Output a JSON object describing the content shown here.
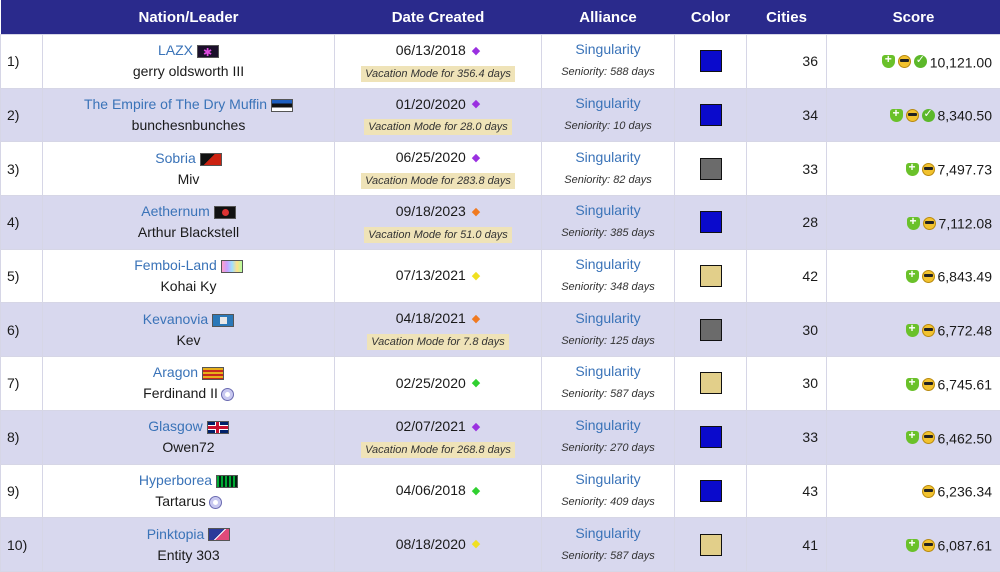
{
  "columns": [
    "Nation/Leader",
    "Date Created",
    "Alliance",
    "Color",
    "Cities",
    "Score"
  ],
  "colors": {
    "header_bg": "#2a2a8c",
    "even_row_bg": "#d8d8ee",
    "link": "#3a73b8",
    "vacation_bg": "#efe3b8",
    "blue": "#0a0acc",
    "gray": "#6b6b6b",
    "beige": "#e2cf8a",
    "diamond_purple": "#9a30e0",
    "diamond_orange": "#f07a20",
    "diamond_yellow": "#f0e020",
    "diamond_green": "#30d030"
  },
  "rows": [
    {
      "rank": "1)",
      "nation": "LAZX",
      "flag": "lazx",
      "leader": "gerry oldsworth III",
      "leader_badge": false,
      "date": "06/13/2018",
      "diamond": "purple",
      "vacation": "Vacation Mode for 356.4 days",
      "alliance": "Singularity",
      "seniority": "Seniority: 588 days",
      "color": "blue",
      "cities": "36",
      "score": "10,121.00",
      "icons": [
        "shield-plus-icon",
        "sunglasses-face-icon",
        "check-badge-icon"
      ]
    },
    {
      "rank": "2)",
      "nation": "The Empire of The Dry Muffin",
      "flag": "estonia",
      "leader": "bunchesnbunches",
      "leader_badge": false,
      "date": "01/20/2020",
      "diamond": "purple",
      "vacation": "Vacation Mode for 28.0 days",
      "alliance": "Singularity",
      "seniority": "Seniority: 10 days",
      "color": "blue",
      "cities": "34",
      "score": "8,340.50",
      "icons": [
        "shield-plus-icon",
        "sunglasses-face-icon",
        "check-badge-icon"
      ]
    },
    {
      "rank": "3)",
      "nation": "Sobria",
      "flag": "sobria",
      "leader": "Miv",
      "leader_badge": false,
      "date": "06/25/2020",
      "diamond": "purple",
      "vacation": "Vacation Mode for 283.8 days",
      "alliance": "Singularity",
      "seniority": "Seniority: 82 days",
      "color": "gray",
      "cities": "33",
      "score": "7,497.73",
      "icons": [
        "shield-plus-icon",
        "sunglasses-face-icon"
      ]
    },
    {
      "rank": "4)",
      "nation": "Aethernum",
      "flag": "aethernum",
      "leader": "Arthur Blackstell",
      "leader_badge": false,
      "date": "09/18/2023",
      "diamond": "orange",
      "vacation": "Vacation Mode for 51.0 days",
      "alliance": "Singularity",
      "seniority": "Seniority: 385 days",
      "color": "blue",
      "cities": "28",
      "score": "7,112.08",
      "icons": [
        "shield-plus-icon",
        "sunglasses-face-icon"
      ]
    },
    {
      "rank": "5)",
      "nation": "Femboi-Land",
      "flag": "femboi",
      "leader": "Kohai Ky",
      "leader_badge": false,
      "date": "07/13/2021",
      "diamond": "yellow",
      "vacation": "",
      "alliance": "Singularity",
      "seniority": "Seniority: 348 days",
      "color": "beige",
      "cities": "42",
      "score": "6,843.49",
      "icons": [
        "shield-plus-icon",
        "sunglasses-face-icon"
      ]
    },
    {
      "rank": "6)",
      "nation": "Kevanovia",
      "flag": "kevanovia",
      "leader": "Kev",
      "leader_badge": false,
      "date": "04/18/2021",
      "diamond": "orange",
      "vacation": "Vacation Mode for 7.8 days",
      "alliance": "Singularity",
      "seniority": "Seniority: 125 days",
      "color": "gray",
      "cities": "30",
      "score": "6,772.48",
      "icons": [
        "shield-plus-icon",
        "sunglasses-face-icon"
      ]
    },
    {
      "rank": "7)",
      "nation": "Aragon",
      "flag": "aragon",
      "leader": "Ferdinand II",
      "leader_badge": true,
      "date": "02/25/2020",
      "diamond": "green",
      "vacation": "",
      "alliance": "Singularity",
      "seniority": "Seniority: 587 days",
      "color": "beige",
      "cities": "30",
      "score": "6,745.61",
      "icons": [
        "shield-plus-icon",
        "sunglasses-face-icon"
      ]
    },
    {
      "rank": "8)",
      "nation": "Glasgow",
      "flag": "uk",
      "leader": "Owen72",
      "leader_badge": false,
      "date": "02/07/2021",
      "diamond": "purple",
      "vacation": "Vacation Mode for 268.8 days",
      "alliance": "Singularity",
      "seniority": "Seniority: 270 days",
      "color": "blue",
      "cities": "33",
      "score": "6,462.50",
      "icons": [
        "shield-plus-icon",
        "sunglasses-face-icon"
      ]
    },
    {
      "rank": "9)",
      "nation": "Hyperborea",
      "flag": "hyper",
      "leader": "Tartarus",
      "leader_badge": true,
      "date": "04/06/2018",
      "diamond": "green",
      "vacation": "",
      "alliance": "Singularity",
      "seniority": "Seniority: 409 days",
      "color": "blue",
      "cities": "43",
      "score": "6,236.34",
      "icons": [
        "sunglasses-face-icon"
      ]
    },
    {
      "rank": "10)",
      "nation": "Pinktopia",
      "flag": "pinktopia",
      "leader": "Entity 303",
      "leader_badge": false,
      "date": "08/18/2020",
      "diamond": "yellow",
      "vacation": "",
      "alliance": "Singularity",
      "seniority": "Seniority: 587 days",
      "color": "beige",
      "cities": "41",
      "score": "6,087.61",
      "icons": [
        "shield-plus-icon",
        "sunglasses-face-icon"
      ]
    }
  ]
}
